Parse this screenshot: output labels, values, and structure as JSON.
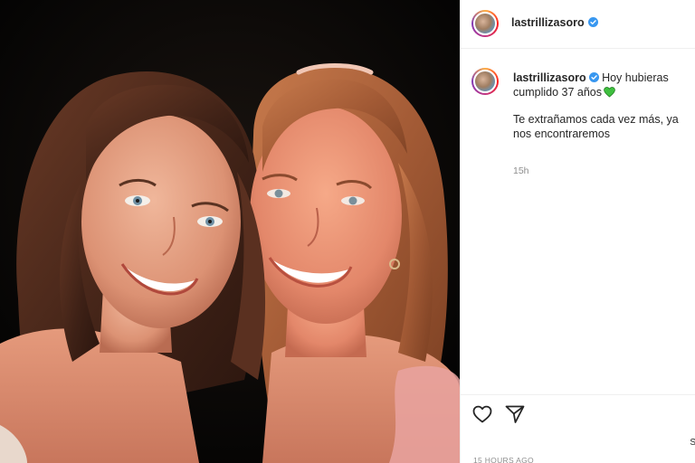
{
  "post": {
    "username": "lastrillizasoro",
    "verified": true,
    "caption_line1": "Hoy hubieras cumplido 37 años",
    "caption_line2": "Te extrañamos cada vez más, ya nos encontraremos",
    "time_short": "15h",
    "time_long": "15 HOURS AGO",
    "save_hint": "S"
  },
  "icons": {
    "verified": "verified-badge-icon",
    "emoji": "green-heart-emoji",
    "like": "heart-outline-icon",
    "share": "paper-plane-icon"
  },
  "colors": {
    "verified_blue": "#3897f0",
    "green_heart": "#3fbf3f",
    "secondary_text": "#8e8e8e",
    "divider": "#efefef"
  }
}
